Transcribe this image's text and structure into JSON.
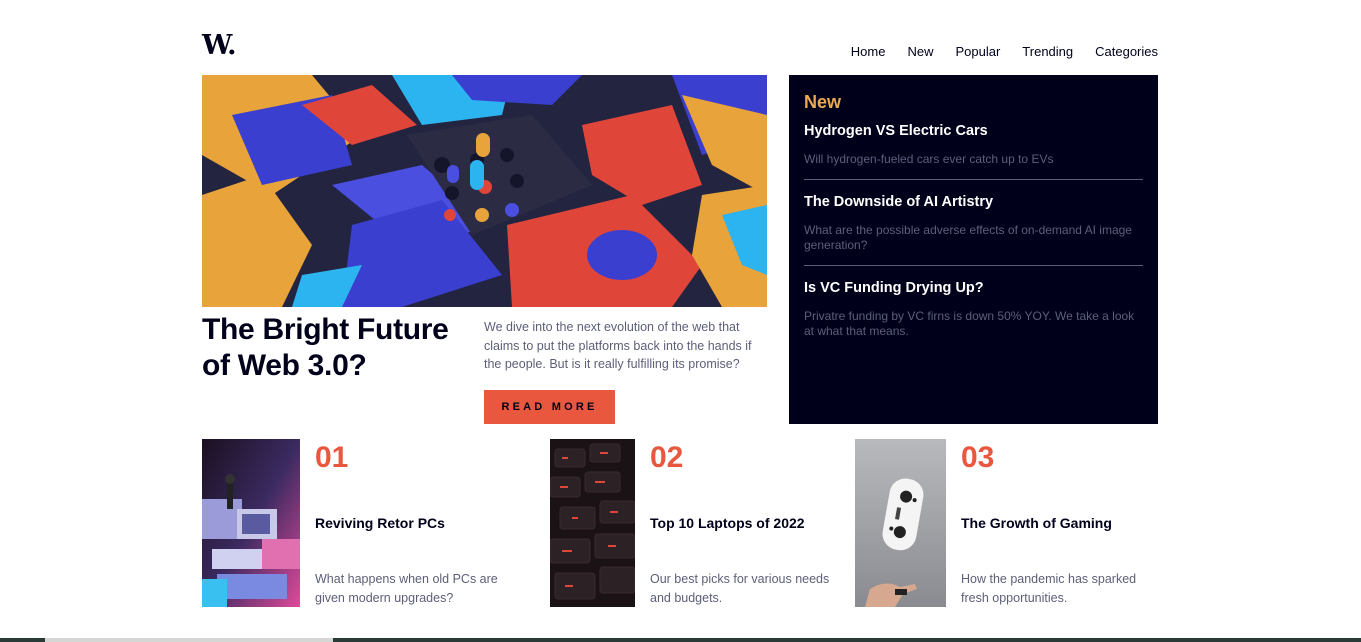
{
  "header": {
    "logo": "W.",
    "nav": [
      "Home",
      "New",
      "Popular",
      "Trending",
      "Categories"
    ]
  },
  "hero": {
    "title": "The Bright Future of Web 3.0?",
    "description": "We dive into the next evolution of the web that claims to put the platforms back into the hands if the people. But is it really fulfilling its promise?",
    "button": "READ MORE"
  },
  "new_panel": {
    "heading": "New",
    "items": [
      {
        "title": "Hydrogen VS Electric Cars",
        "description": "Will hydrogen-fueled cars ever catch up to EVs"
      },
      {
        "title": "The Downside of AI Artistry",
        "description": "What are the possible adverse effects of on-demand AI image generation?"
      },
      {
        "title": "Is VC Funding Drying Up?",
        "description": "Privatre funding by VC firns is down 50% YOY. We take a look at what that means."
      }
    ]
  },
  "cards": [
    {
      "number": "01",
      "title": "Reviving Retor PCs",
      "description": "What happens when old PCs are given modern upgrades?"
    },
    {
      "number": "02",
      "title": "Top 10 Laptops of 2022",
      "description": "Our best picks for various needs and budgets."
    },
    {
      "number": "03",
      "title": "The Growth of Gaming",
      "description": "How the pandemic has sparked fresh opportunities."
    }
  ],
  "colors": {
    "accent": "#e9573f",
    "new_heading": "#e9ab53",
    "dark": "#00001a",
    "muted": "#5d5f79"
  }
}
